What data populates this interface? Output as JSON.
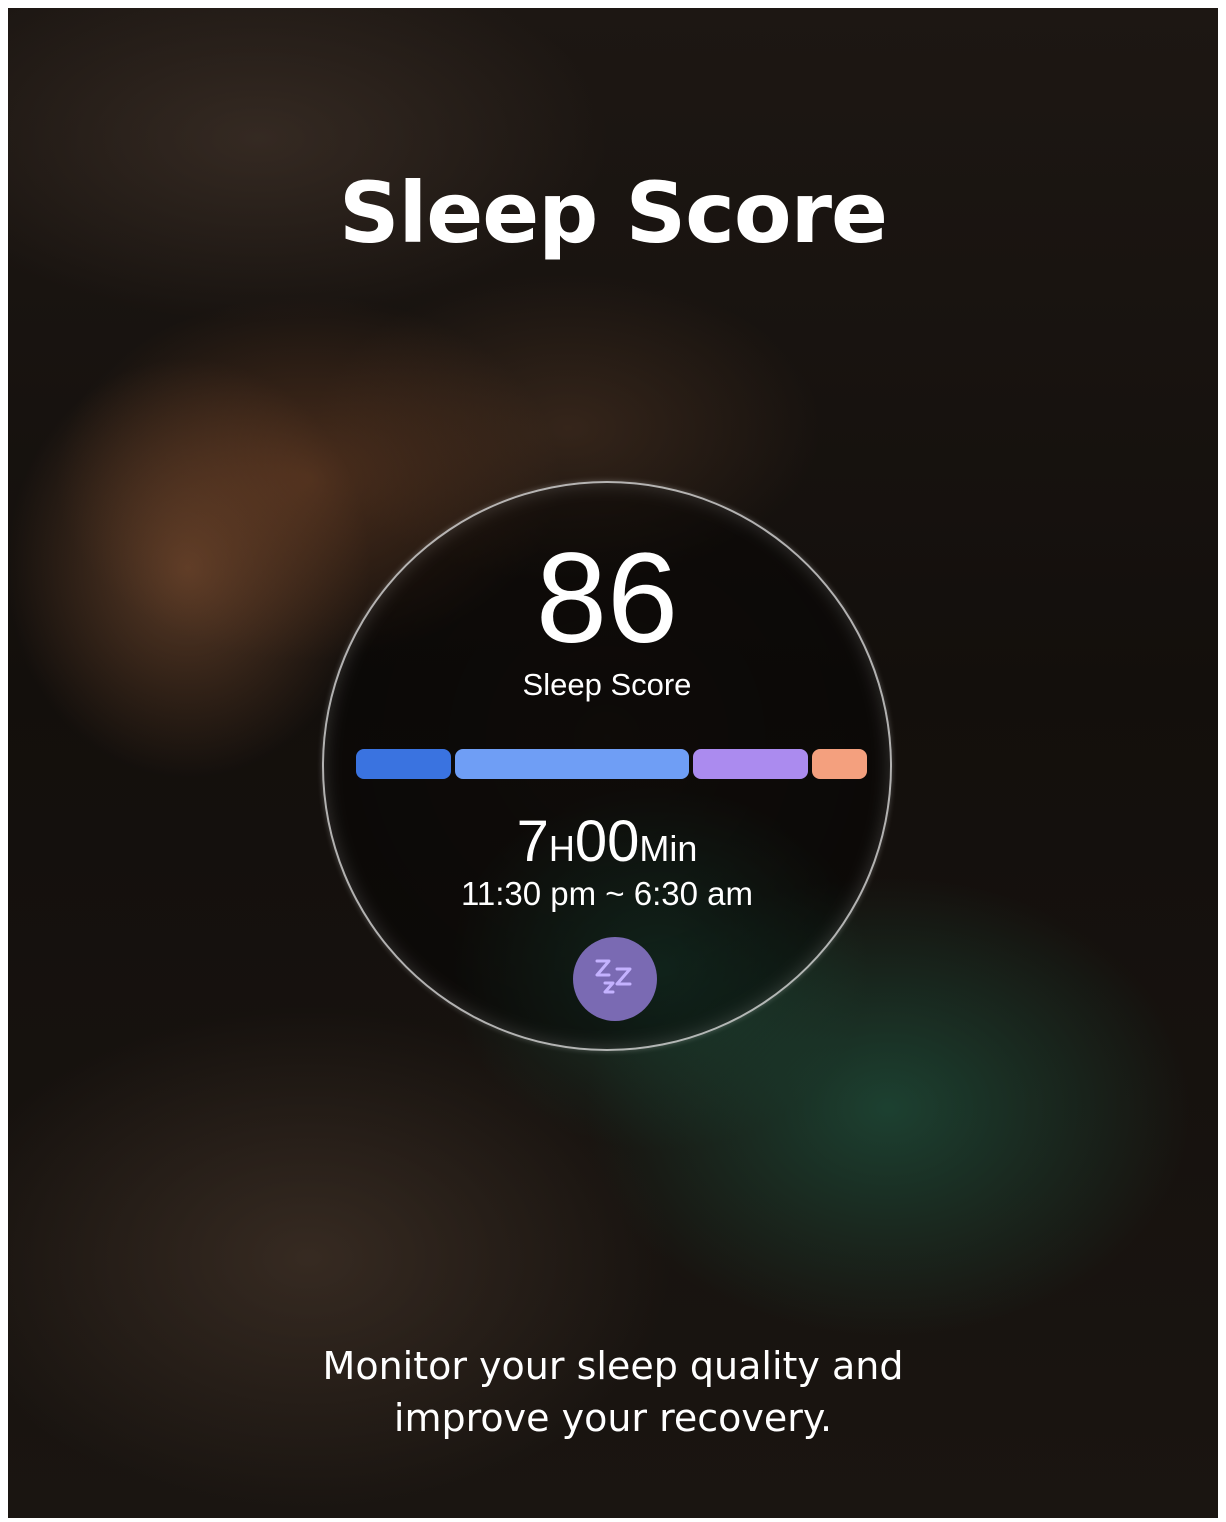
{
  "headline": "Sleep Score",
  "sleep_card": {
    "score": "86",
    "score_label": "Sleep Score",
    "duration": {
      "hours": "7",
      "hours_unit": "H",
      "minutes": "00",
      "minutes_unit": "Min"
    },
    "time_range": "11:30 pm ~ 6:30 am",
    "stages": [
      {
        "color": "#3a73e0",
        "share": 0.19
      },
      {
        "color": "#6f9ef5",
        "share": 0.47
      },
      {
        "color": "#ab8bef",
        "share": 0.23
      },
      {
        "color": "#f4a07e",
        "share": 0.11
      }
    ],
    "sleep_icon": "zzz-icon",
    "accent_color": "#7a6ab3"
  },
  "tagline": {
    "line1": "Monitor your sleep quality and",
    "line2": "improve your recovery."
  }
}
